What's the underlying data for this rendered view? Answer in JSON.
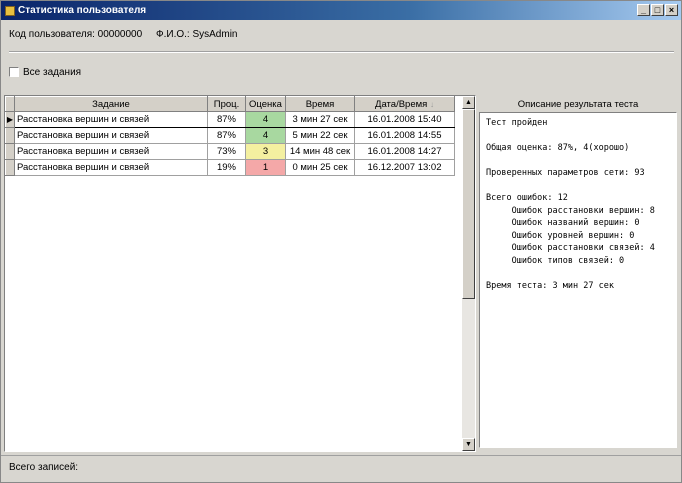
{
  "window": {
    "title": "Статистика пользователя",
    "minimize": "_",
    "maximize": "□",
    "close": "×"
  },
  "header": {
    "user_code_label": "Код пользователя: 00000000",
    "fio_label": "Ф.И.О.: SysAdmin"
  },
  "filter": {
    "all_tasks_label": "Все задания",
    "checked": false
  },
  "grid": {
    "columns": [
      "Задание",
      "Проц.",
      "Оценка",
      "Время",
      "Дата/Время"
    ],
    "sort_indicator": "↓",
    "rows": [
      {
        "task": "Расстановка вершин и связей",
        "pct": "87%",
        "grade": "4",
        "time": "3 мин 27 сек",
        "date": "16.01.2008 15:40",
        "color": "#a8d8a0"
      },
      {
        "task": "Расстановка вершин и связей",
        "pct": "87%",
        "grade": "4",
        "time": "5 мин 22 сек",
        "date": "16.01.2008 14:55",
        "color": "#a8d8a0"
      },
      {
        "task": "Расстановка вершин и связей",
        "pct": "73%",
        "grade": "3",
        "time": "14 мин 48 сек",
        "date": "16.01.2008 14:27",
        "color": "#f4f0a0"
      },
      {
        "task": "Расстановка вершин и связей",
        "pct": "19%",
        "grade": "1",
        "time": "0 мин 25 сек",
        "date": "16.12.2007 13:02",
        "color": "#f4a8a8"
      }
    ]
  },
  "result": {
    "title": "Описание результата теста",
    "lines": [
      "Тест пройден",
      "",
      "Общая оценка: 87%, 4(хорошо)",
      "",
      "Проверенных параметров сети: 93",
      "",
      "Всего ошибок: 12",
      "     Ошибок расстановки вершин: 8",
      "     Ошибок названий вершин: 0",
      "     Ошибок уровней вершин: 0",
      "     Ошибок расстановки связей: 4",
      "     Ошибок типов связей: 0",
      "",
      "Время теста: 3 мин 27 сек"
    ]
  },
  "status": {
    "total_label": "Всего записей:"
  }
}
